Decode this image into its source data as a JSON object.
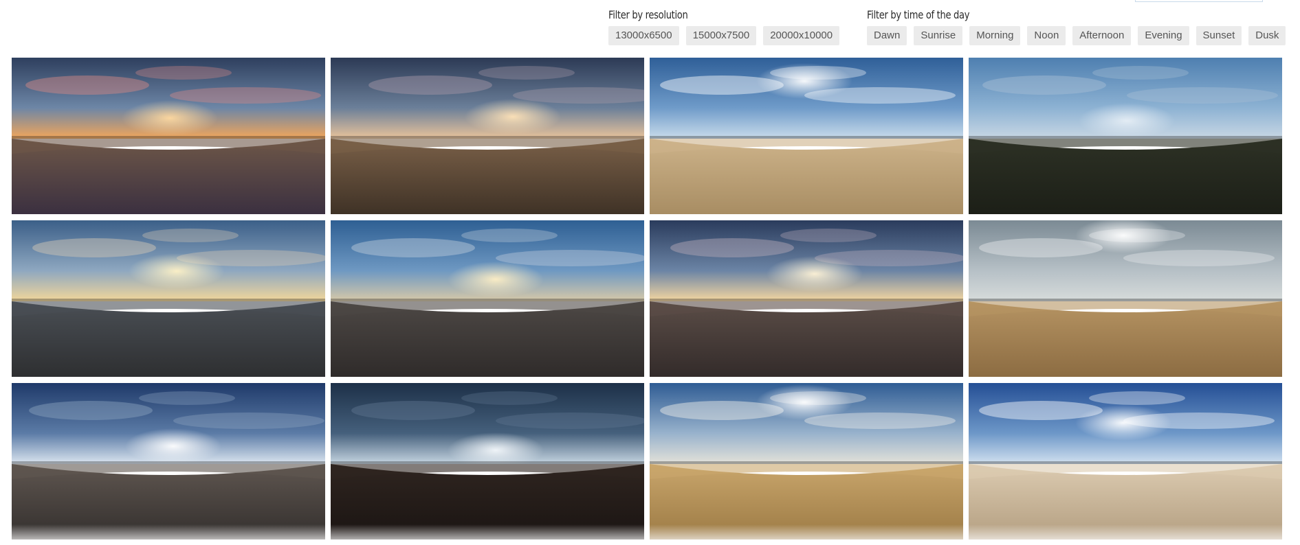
{
  "filters": {
    "resolution": {
      "title": "Filter by resolution",
      "options": [
        "13000x6500",
        "15000x7500",
        "20000x10000"
      ]
    },
    "time_of_day": {
      "title": "Filter by time of the day",
      "options": [
        "Dawn",
        "Sunrise",
        "Morning",
        "Noon",
        "Afternoon",
        "Evening",
        "Sunset",
        "Dusk"
      ]
    }
  },
  "thumbnails": [
    {
      "sky_top": "#2e3f5e",
      "sky_mid": "#6d86a6",
      "horizon": "#f2a65a",
      "ground": "#6e5748",
      "ground_dark": "#3b3040",
      "sun": "#ffd9a0",
      "clouds": "#d98a86"
    },
    {
      "sky_top": "#2c3a55",
      "sky_mid": "#6b7f99",
      "horizon": "#e9c39a",
      "ground": "#7a6048",
      "ground_dark": "#3f3226",
      "sun": "#ffe3b8",
      "clouds": "#a89aa8"
    },
    {
      "sky_top": "#2f5f98",
      "sky_mid": "#6f9bc9",
      "horizon": "#c9dceb",
      "ground": "#cdb38a",
      "ground_dark": "#a88d63",
      "sun": "#ffffff",
      "clouds": "#ffffff"
    },
    {
      "sky_top": "#4e7fb0",
      "sky_mid": "#8db2d3",
      "horizon": "#c8d7e4",
      "ground": "#2d3125",
      "ground_dark": "#1c1f17",
      "sun": "#e6eef5",
      "clouds": "#a8bfd4"
    },
    {
      "sky_top": "#3b5f88",
      "sky_mid": "#8ea7c0",
      "horizon": "#f3d79a",
      "ground": "#4a4f55",
      "ground_dark": "#2e2f31",
      "sun": "#fff2c6",
      "clouds": "#d7c9b5"
    },
    {
      "sky_top": "#2e5f93",
      "sky_mid": "#6e98c2",
      "horizon": "#d8c9a8",
      "ground": "#4d4845",
      "ground_dark": "#2f2b2a",
      "sun": "#ffefc5",
      "clouds": "#c2cedb"
    },
    {
      "sky_top": "#2a3b5c",
      "sky_mid": "#6b84a5",
      "horizon": "#f6d7a0",
      "ground": "#5b4d47",
      "ground_dark": "#332b2a",
      "sun": "#fff3d6",
      "clouds": "#b7aab8"
    },
    {
      "sky_top": "#7b8a94",
      "sky_mid": "#b6c0c6",
      "horizon": "#d7dcdb",
      "ground": "#b69463",
      "ground_dark": "#8c6c42",
      "sun": "#ffffff",
      "clouds": "#e6e9ea"
    },
    {
      "sky_top": "#1f3a6a",
      "sky_mid": "#5b7ba6",
      "horizon": "#dce6f0",
      "ground": "#5f5650",
      "ground_dark": "#332f2d",
      "sun": "#ffffff",
      "clouds": "#8ca3bf"
    },
    {
      "sky_top": "#1d3048",
      "sky_mid": "#45607c",
      "horizon": "#c7d6e2",
      "ground": "#2f2520",
      "ground_dark": "#1a1412",
      "sun": "#f4f8fb",
      "clouds": "#5f7690"
    },
    {
      "sky_top": "#2f5c94",
      "sky_mid": "#98b2cc",
      "horizon": "#e4e2d9",
      "ground": "#c9a66c",
      "ground_dark": "#9c7a44",
      "sun": "#ffffff",
      "clouds": "#f3f1ea"
    },
    {
      "sky_top": "#244f95",
      "sky_mid": "#6d97c8",
      "horizon": "#d2e1ef",
      "ground": "#dccbb1",
      "ground_dark": "#b39e80",
      "sun": "#ffffff",
      "clouds": "#ffffff"
    }
  ]
}
